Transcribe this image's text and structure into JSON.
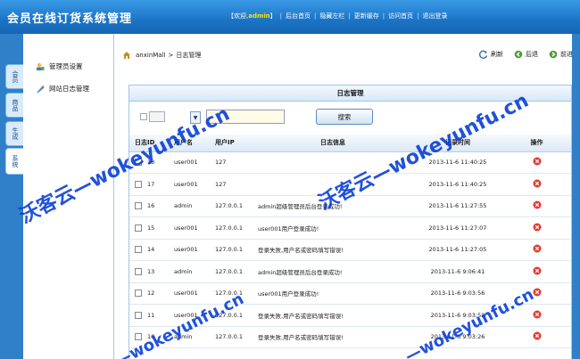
{
  "header": {
    "app_title": "会员在线订货系统管理",
    "welcome_prefix": "【欢迎,",
    "user": "admin",
    "welcome_suffix": "】",
    "nav": [
      "后台首页",
      "隐藏左栏",
      "更新缓存",
      "访问首页",
      "退出登录"
    ]
  },
  "vtabs": [
    {
      "label": "会员",
      "active": false
    },
    {
      "label": "商品",
      "active": false
    },
    {
      "label": "生成",
      "active": false
    },
    {
      "label": "系统",
      "active": true
    }
  ],
  "sidebar": {
    "items": [
      {
        "label": "管理员设置",
        "icon": "admin-settings-icon"
      },
      {
        "label": "网站日志管理",
        "icon": "log-management-icon"
      }
    ]
  },
  "breadcrumb": {
    "root": "anxinMall",
    "sep": ">",
    "current": "日志管理"
  },
  "toolbar": {
    "refresh": "刷新",
    "back": "后退",
    "forward": "前进"
  },
  "panel": {
    "title": "日志管理"
  },
  "search": {
    "value": "",
    "button": "搜索",
    "arrow": "▼"
  },
  "table": {
    "headers": [
      "日志ID",
      "用户名",
      "用户IP",
      "日志信息",
      "记录时间",
      "操作"
    ],
    "rows": [
      {
        "id": "18",
        "user": "user001",
        "ip": "127",
        "info": "",
        "time": "2013-11-6 11:40:25"
      },
      {
        "id": "17",
        "user": "user001",
        "ip": "127",
        "info": "",
        "time": "2013-11-6 11:40:25"
      },
      {
        "id": "16",
        "user": "admin",
        "ip": "127.0.0.1",
        "info": "admin超级管理员后台登录成功!",
        "time": "2013-11-6 11:27:55"
      },
      {
        "id": "15",
        "user": "user001",
        "ip": "127.0.0.1",
        "info": "user001用户登录成功!",
        "time": "2013-11-6 11:27:07"
      },
      {
        "id": "14",
        "user": "user001",
        "ip": "127.0.0.1",
        "info": "登录失败,用户名或密码填写错误!",
        "time": "2013-11-6 11:27:05"
      },
      {
        "id": "13",
        "user": "admin",
        "ip": "127.0.0.1",
        "info": "admin超级管理员后台登录成功!",
        "time": "2013-11-6 9:06:41"
      },
      {
        "id": "12",
        "user": "user001",
        "ip": "127.0.0.1",
        "info": "user001用户登录成功!",
        "time": "2013-11-6 9:03:56"
      },
      {
        "id": "11",
        "user": "user001",
        "ip": "127.0.0.1",
        "info": "登录失败,用户名或密码填写错误!",
        "time": "2013-11-6 9:03:52"
      },
      {
        "id": "10",
        "user": "admin",
        "ip": "127.0.0.1",
        "info": "登录失败,用户名或密码填写错误!",
        "time": "2013-11-6 9:03:26"
      }
    ]
  },
  "watermark": {
    "cn": "沃客云",
    "url": "—wokeyunfu.cn"
  },
  "colors": {
    "header": "#1b74c6",
    "accent_yellow": "#ffe200",
    "delete_red": "#e23a2f",
    "watermark": "#0a3fd6"
  }
}
